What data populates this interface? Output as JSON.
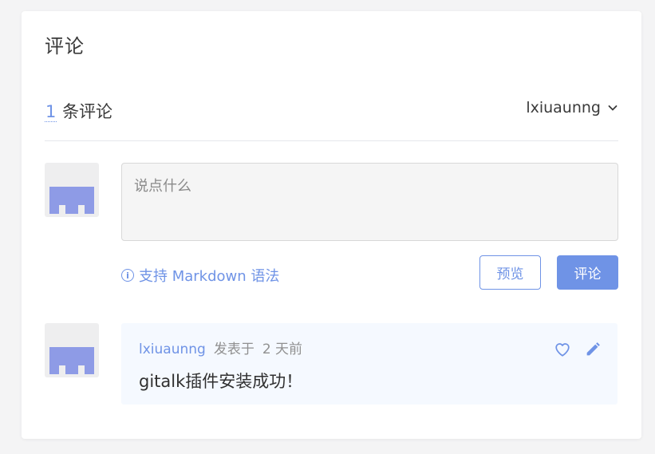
{
  "header": {
    "title": "评论"
  },
  "stats": {
    "count": "1",
    "count_suffix": "条评论"
  },
  "user": {
    "name": "lxiuaunng"
  },
  "editor": {
    "placeholder": "说点什么"
  },
  "markdown_tip": {
    "icon": "i",
    "label": "支持 Markdown 语法"
  },
  "buttons": {
    "preview": "预览",
    "submit": "评论"
  },
  "comments": [
    {
      "author": "lxiuaunng",
      "posted_label": "发表于",
      "time": "2 天前",
      "body": "gitalk插件安装成功！"
    }
  ],
  "colors": {
    "accent": "#6f93e6",
    "avatar": "#8e9be6",
    "comment_bg": "#f5f9ff"
  },
  "icons": [
    "chevron-down-icon",
    "info-icon",
    "heart-icon",
    "edit-icon",
    "avatar-identicon"
  ]
}
